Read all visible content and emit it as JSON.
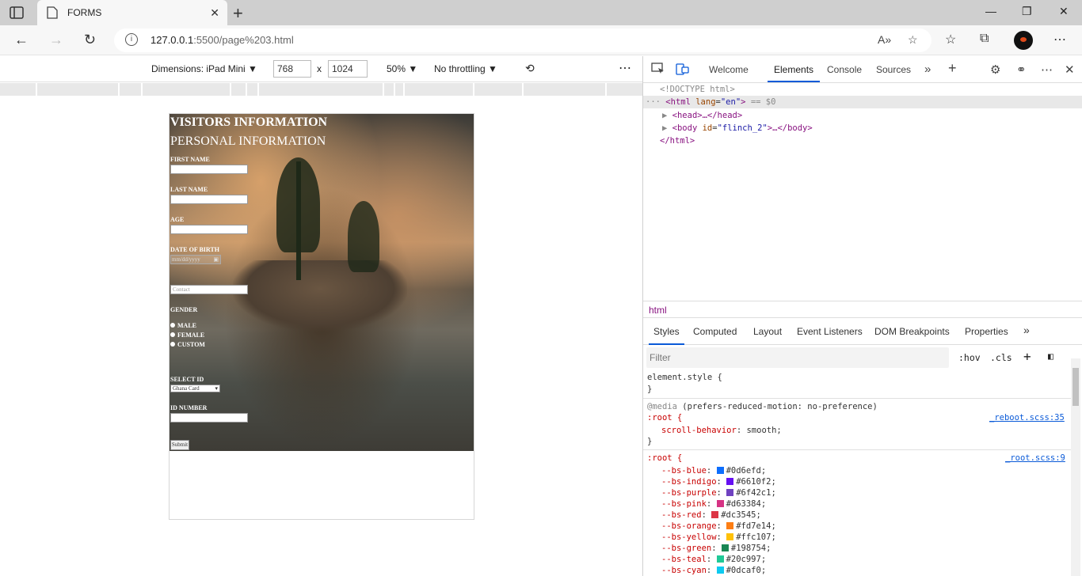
{
  "browser": {
    "tab_title": "FORMS",
    "url_host": "127.0.0.1",
    "url_rest": ":5500/page%203.html"
  },
  "device_toolbar": {
    "dimensions_label": "Dimensions: iPad Mini",
    "width": "768",
    "height": "1024",
    "times": "x",
    "zoom": "50%",
    "throttling": "No throttling"
  },
  "page": {
    "heading": "VISITORS INFORMATION",
    "subheading": "PERSONAL INFORMATION",
    "first_name_label": "FIRST NAME",
    "last_name_label": "LAST NAME",
    "age_label": "AGE",
    "dob_label": "DATE OF BIRTH",
    "dob_placeholder": "mm/dd/yyyy",
    "contact_placeholder": "Contact",
    "gender_label": "GENDER",
    "gender_options": [
      "MALE",
      "FEMALE",
      "CUSTOM"
    ],
    "select_id_label": "SELECT ID",
    "select_id_value": "Ghana Card",
    "id_number_label": "ID NUMBER",
    "submit_label": "Submit"
  },
  "devtools": {
    "tabs": [
      "Welcome",
      "Elements",
      "Console",
      "Sources"
    ],
    "active_tab": "Elements",
    "dom": {
      "doctype": "<!DOCTYPE html>",
      "html_open_tag": "<html",
      "html_attr": "lang",
      "html_attr_val": "\"en\"",
      "html_suffix": "== $0",
      "head": "<head>…</head>",
      "body_tag": "<body",
      "body_attr": "id",
      "body_attr_val": "\"flinch_2\"",
      "body_close": ">…</body>",
      "html_close": "</html>"
    },
    "breadcrumb": "html",
    "styles_tabs": [
      "Styles",
      "Computed",
      "Layout",
      "Event Listeners",
      "DOM Breakpoints",
      "Properties"
    ],
    "filter_placeholder": "Filter",
    "hov": ":hov",
    "cls": ".cls",
    "css": {
      "element_style": "element.style {",
      "close_brace": "}",
      "media": "@media",
      "media_query": "(prefers-reduced-motion: no-preference)",
      "root_selector": ":root {",
      "reboot_link": "_reboot.scss:35",
      "scroll_prop": "scroll-behavior",
      "scroll_val": "smooth;",
      "root_link": "_root.scss:9",
      "vars": [
        {
          "name": "--bs-blue",
          "value": "#0d6efd;",
          "color": "#0d6efd"
        },
        {
          "name": "--bs-indigo",
          "value": "#6610f2;",
          "color": "#6610f2"
        },
        {
          "name": "--bs-purple",
          "value": "#6f42c1;",
          "color": "#6f42c1"
        },
        {
          "name": "--bs-pink",
          "value": "#d63384;",
          "color": "#d63384"
        },
        {
          "name": "--bs-red",
          "value": "#dc3545;",
          "color": "#dc3545"
        },
        {
          "name": "--bs-orange",
          "value": "#fd7e14;",
          "color": "#fd7e14"
        },
        {
          "name": "--bs-yellow",
          "value": "#ffc107;",
          "color": "#ffc107"
        },
        {
          "name": "--bs-green",
          "value": "#198754;",
          "color": "#198754"
        },
        {
          "name": "--bs-teal",
          "value": "#20c997;",
          "color": "#20c997"
        },
        {
          "name": "--bs-cyan",
          "value": "#0dcaf0;",
          "color": "#0dcaf0"
        }
      ]
    }
  }
}
